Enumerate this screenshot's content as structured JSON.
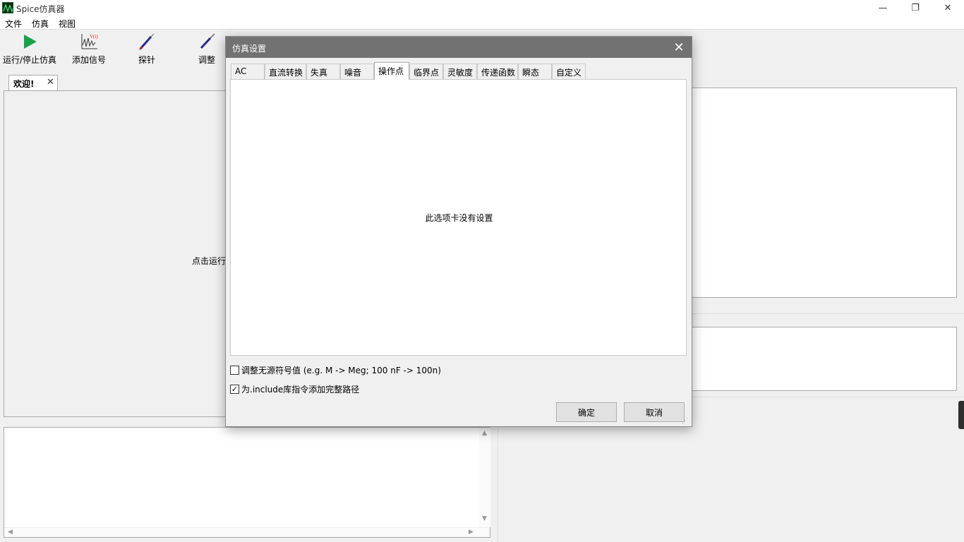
{
  "app": {
    "title": "Spice仿真器"
  },
  "window_controls": {
    "minimize": "—",
    "restore": "❐",
    "close": "✕"
  },
  "menu": [
    "文件",
    "仿真",
    "视图"
  ],
  "toolbar": {
    "run_stop": "运行/停止仿真",
    "add_signal": "添加信号",
    "probe": "探针",
    "adjust": "调整"
  },
  "document": {
    "tab_label": "欢迎!",
    "tab_close": "✕",
    "hint": "点击运行"
  },
  "scroll_arrows": {
    "up": "▲",
    "down": "▼",
    "left": "◀",
    "right": "▶"
  },
  "dialog": {
    "title": "仿真设置",
    "close": "✕",
    "tabs": [
      "AC",
      "直流转换",
      "失真",
      "噪音",
      "操作点",
      "临界点",
      "灵敏度",
      "传递函数",
      "瞬态",
      "自定义"
    ],
    "active_tab_index": 4,
    "empty_message": "此选项卡没有设置",
    "checkboxes": [
      {
        "label": "调整无源符号值 (e.g. M -> Meg; 100 nF -> 100n)",
        "checked": false
      },
      {
        "label": "为.include库指令添加完整路径",
        "checked": true
      }
    ],
    "check_mark": "✓",
    "ok": "确定",
    "cancel": "取消",
    "resize_grip": "⋰"
  },
  "colors": {
    "dialog_titlebar": "#727272",
    "run_icon": "#17a34a",
    "probe_icon": "#2a2a8a"
  }
}
